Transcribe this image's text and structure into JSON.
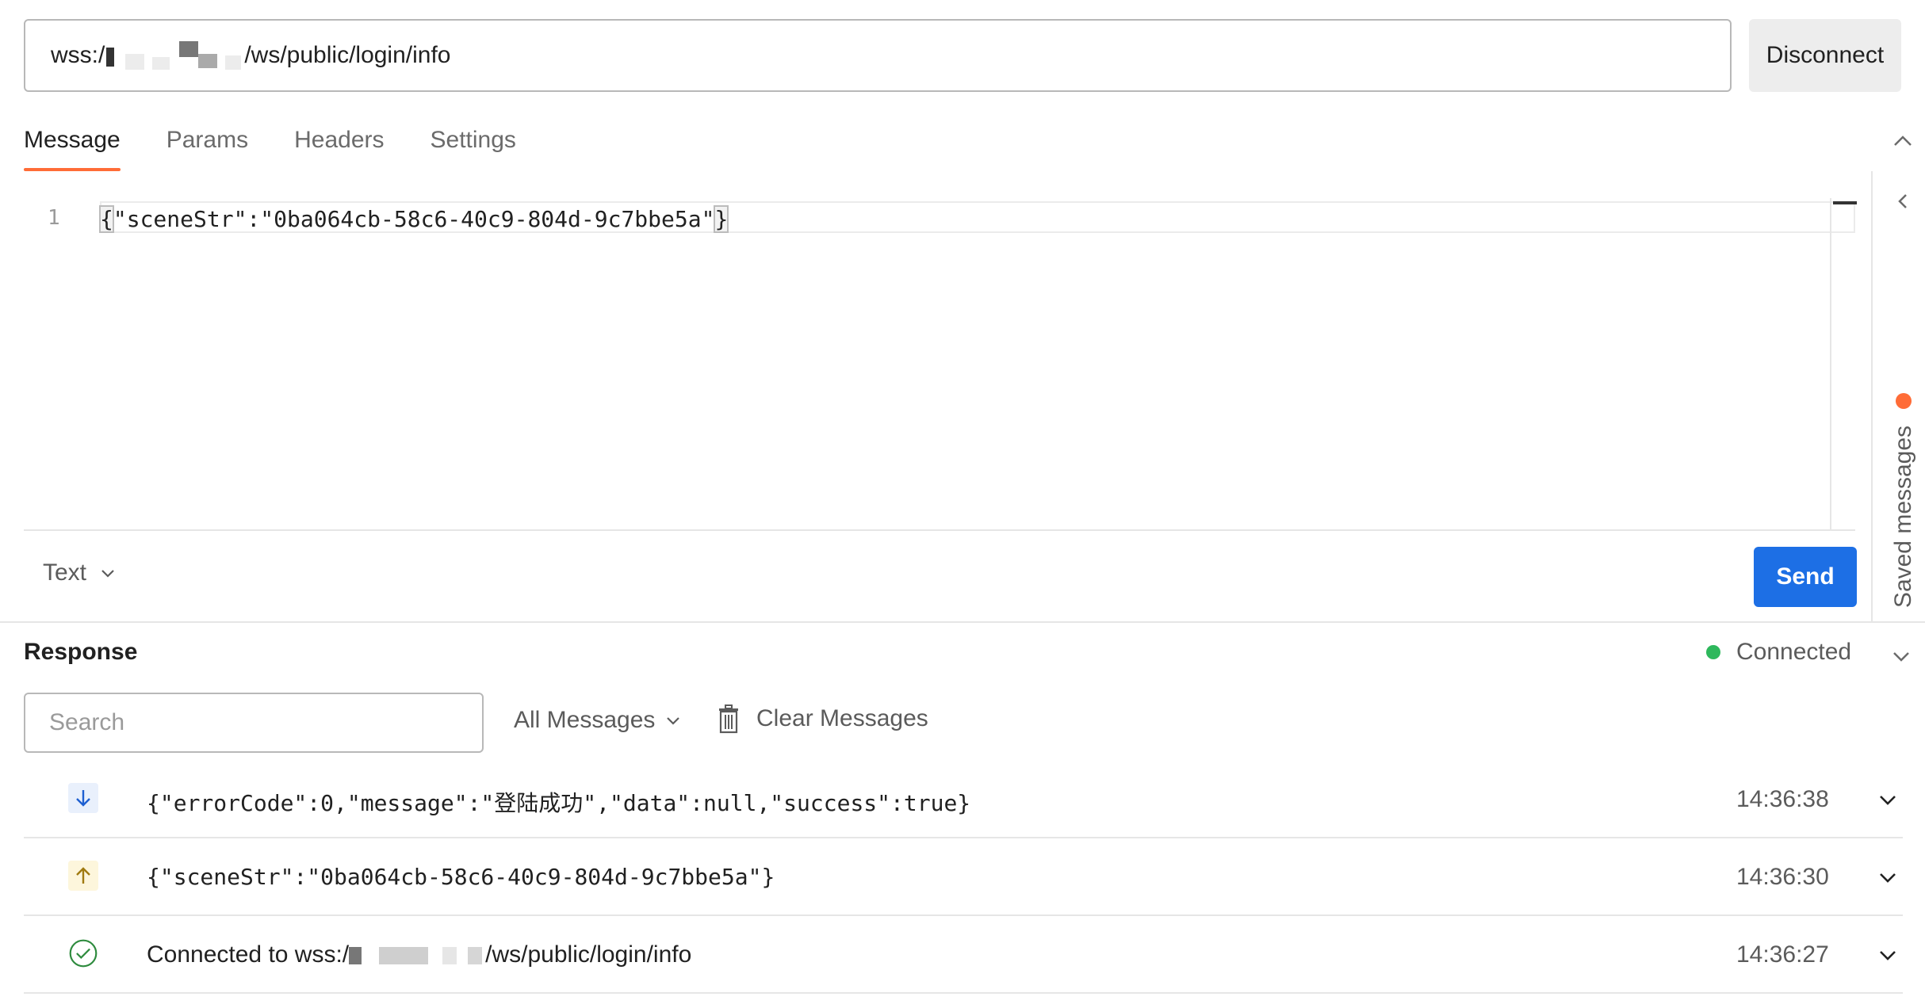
{
  "url_bar": {
    "prefix": "wss:/",
    "suffix": "/ws/public/login/info",
    "disconnect_label": "Disconnect"
  },
  "tabs": [
    {
      "label": "Message",
      "active": true
    },
    {
      "label": "Params",
      "active": false
    },
    {
      "label": "Headers",
      "active": false
    },
    {
      "label": "Settings",
      "active": false
    }
  ],
  "editor": {
    "line_number": "1",
    "code_open": "{",
    "code_body": "\"sceneStr\":\"0ba064cb-58c6-40c9-804d-9c7bbe5a\"",
    "code_close": "}"
  },
  "format": {
    "selected": "Text"
  },
  "send_label": "Send",
  "saved_messages_label": "Saved messages",
  "response": {
    "title": "Response",
    "status": "Connected",
    "status_color": "#2eb85c",
    "search_placeholder": "Search",
    "filter_label": "All Messages",
    "clear_label": "Clear Messages",
    "messages": [
      {
        "direction": "incoming",
        "icon": "arrow-down-icon",
        "text": "{\"errorCode\":0,\"message\":\"登陆成功\",\"data\":null,\"success\":true}",
        "time": "14:36:38"
      },
      {
        "direction": "outgoing",
        "icon": "arrow-up-icon",
        "text": "{\"sceneStr\":\"0ba064cb-58c6-40c9-804d-9c7bbe5a\"}",
        "time": "14:36:30"
      },
      {
        "direction": "connection",
        "icon": "check-circle-icon",
        "text_prefix": "Connected to wss:/",
        "text_suffix": "/ws/public/login/info",
        "time": "14:36:27"
      }
    ]
  },
  "colors": {
    "accent": "#ff6c37",
    "primary_button": "#1d6fe5",
    "incoming_icon_bg": "#e9f0fc",
    "outgoing_icon_bg": "#fdf6dc",
    "connection_icon": "#2e8b3e"
  }
}
